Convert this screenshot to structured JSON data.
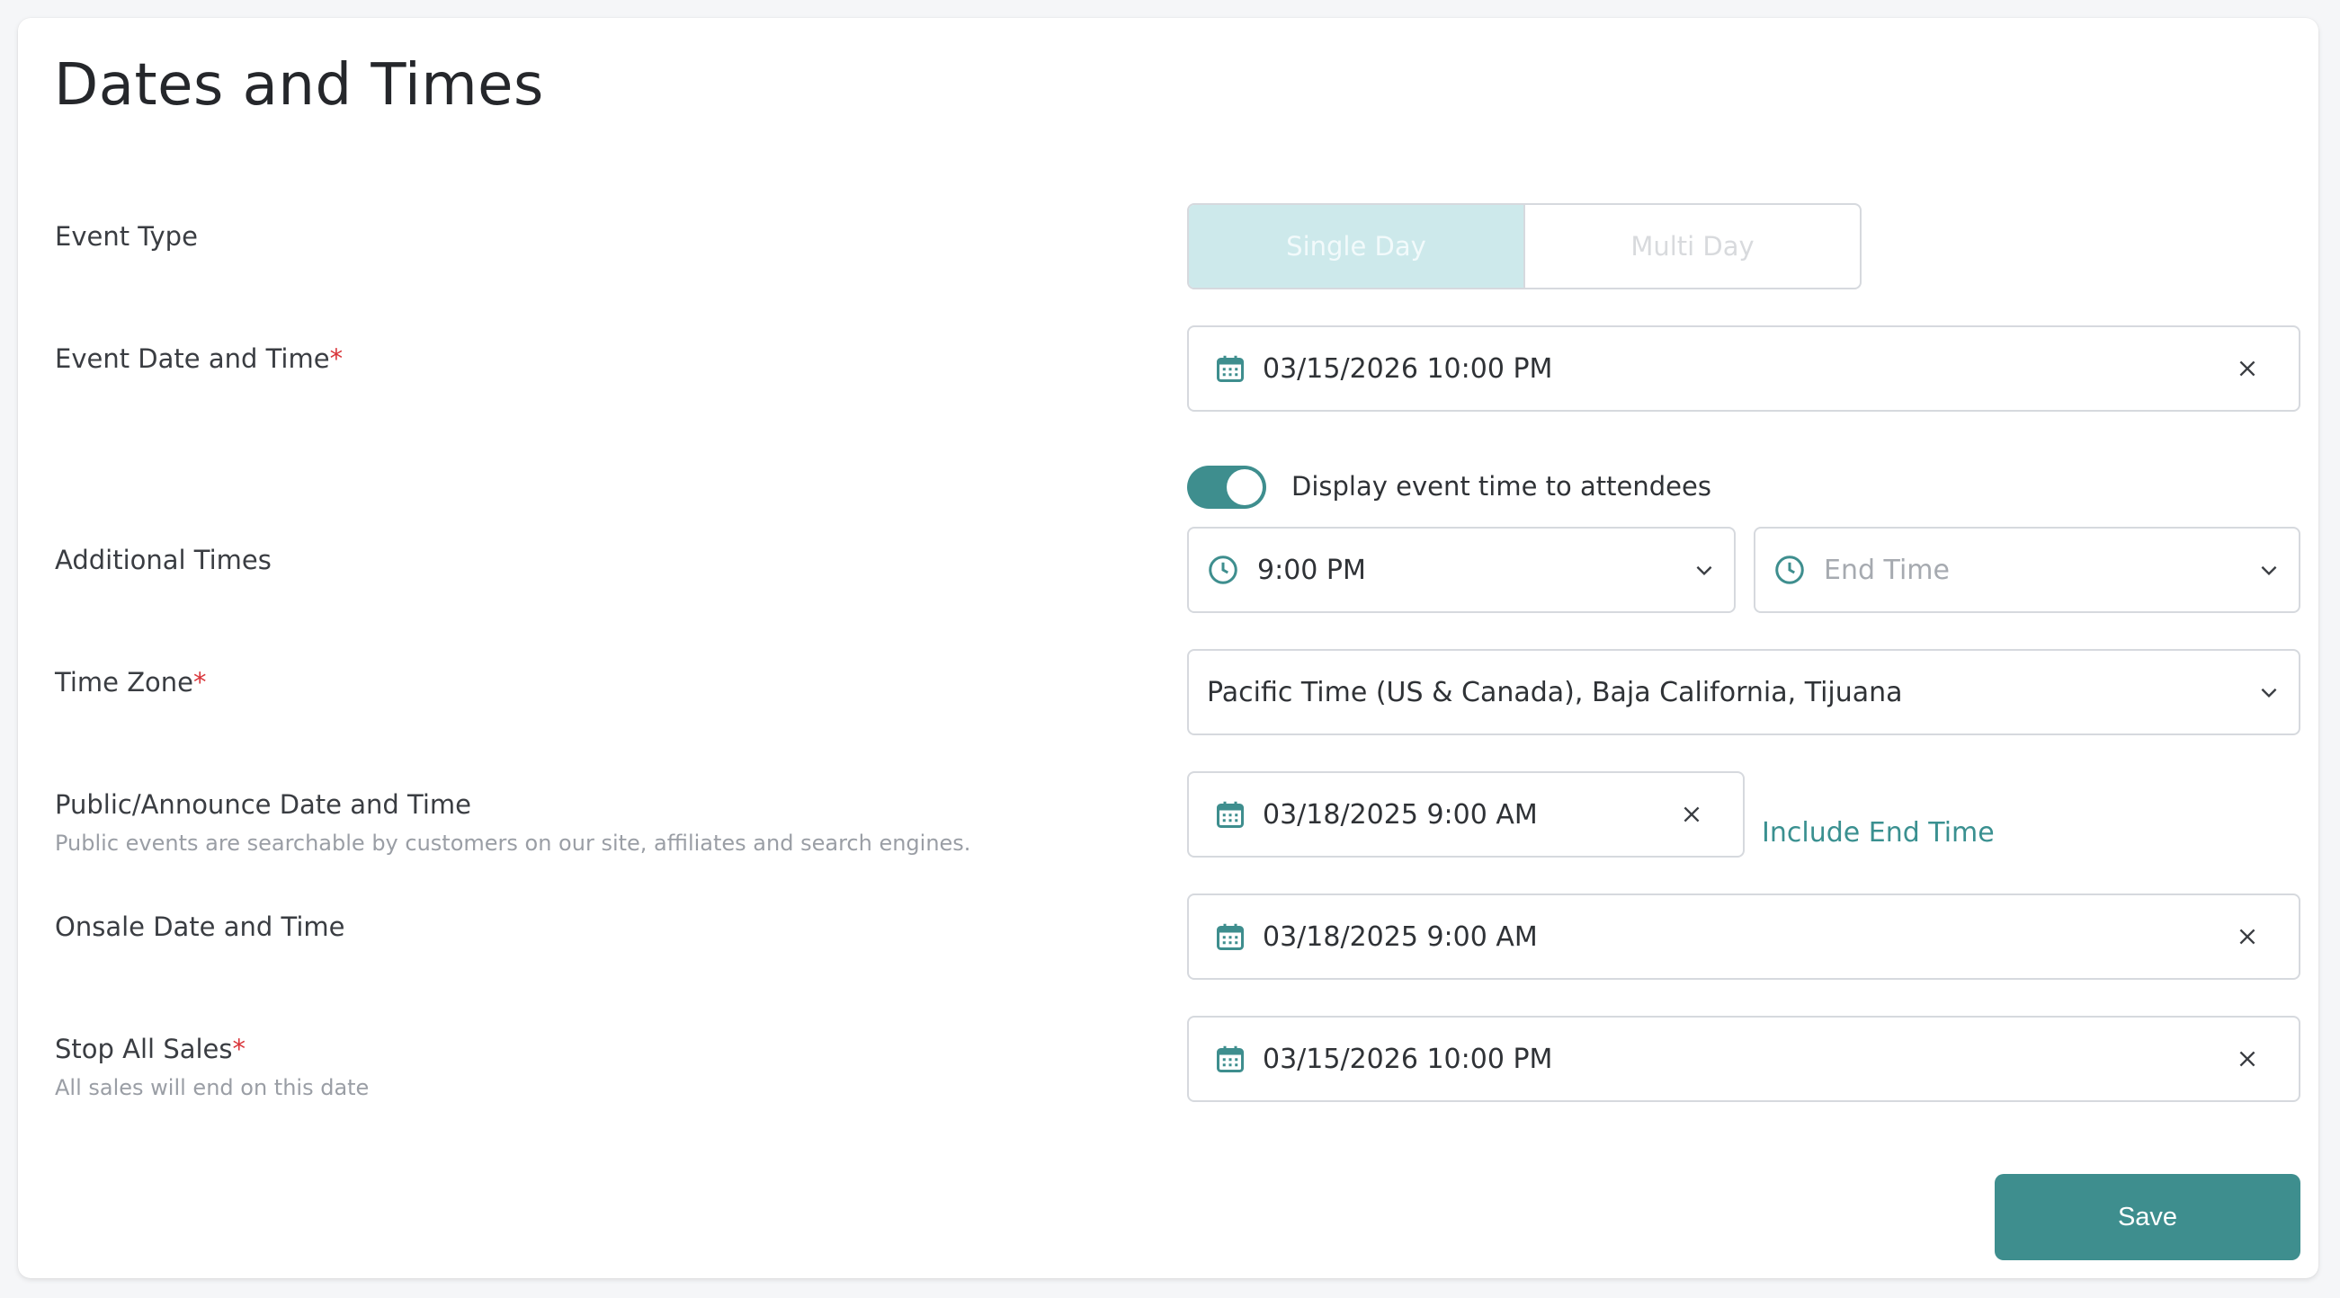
{
  "page": {
    "title": "Dates and Times"
  },
  "colors": {
    "accent": "#3e8e8e",
    "required": "#d9353a",
    "segment_active_bg": "#cde9eb"
  },
  "event_type": {
    "label": "Event Type",
    "options": [
      "Single Day",
      "Multi Day"
    ],
    "selected": "Single Day"
  },
  "event_datetime": {
    "label": "Event Date and Time",
    "required_mark": "*",
    "value": "03/15/2026 10:00 PM",
    "icon": "calendar-icon",
    "display_toggle": {
      "label": "Display event time to attendees",
      "on": true
    }
  },
  "additional_times": {
    "label": "Additional Times",
    "start_value": "9:00 PM",
    "end_placeholder": "End Time",
    "icon": "clock-icon"
  },
  "time_zone": {
    "label": "Time Zone",
    "required_mark": "*",
    "value": "Pacific Time (US & Canada), Baja California, Tijuana"
  },
  "public_announce": {
    "label": "Public/Announce Date and Time",
    "hint": "Public events are searchable by customers on our site, affiliates and search engines.",
    "value": "03/18/2025 9:00 AM",
    "include_end_link": "Include End Time"
  },
  "onsale": {
    "label": "Onsale Date and Time",
    "value": "03/18/2025 9:00 AM"
  },
  "stop_sales": {
    "label": "Stop All Sales",
    "required_mark": "*",
    "hint": "All sales will end on this date",
    "value": "03/15/2026 10:00 PM"
  },
  "actions": {
    "save_label": "Save"
  }
}
